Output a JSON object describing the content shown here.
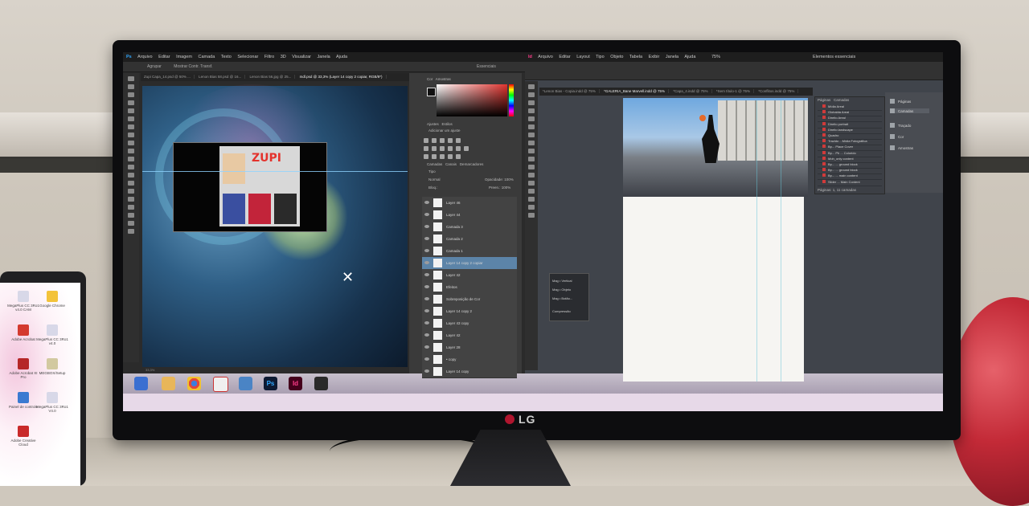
{
  "photoshop": {
    "logo": "Ps",
    "menu": [
      "Arquivo",
      "Editar",
      "Imagem",
      "Camada",
      "Texto",
      "Selecionar",
      "Filtro",
      "3D",
      "Visualizar",
      "Janela",
      "Ajuda"
    ],
    "options_blend": "Agrupar",
    "options_show": "Mostrar Contr. Transf.",
    "workspace": "Essenciais",
    "tabs": [
      "Zupi Capa_14.psd @ 50% ...",
      "Lenon Bias 58.psd @ 16...",
      "Lenon Bias 56.jpg @ 25...",
      "mdl.psd @ 33,3% (Layer 14 copy 2 copiar, RGB/8*)"
    ],
    "canvas_logo": "ZUPI",
    "panels": {
      "color_tabs": [
        "Cor",
        "Amostras"
      ],
      "adjustments_tabs": [
        "Ajustes",
        "Estilos"
      ],
      "adjustments_title": "Adicionar um ajuste",
      "layers_tabs": [
        "Camadas",
        "Canais",
        "Demarcadores"
      ],
      "kind_label": "Tipo",
      "mode": "Normal",
      "opacity_label": "Opacidade:",
      "opacity_value": "100%",
      "lock_label": "Bloq.:",
      "fill_label": "Preen.:",
      "fill_value": "100%"
    },
    "layers": [
      {
        "name": "Layer 46"
      },
      {
        "name": "Layer 44"
      },
      {
        "name": "Camada 3"
      },
      {
        "name": "Camada 2"
      },
      {
        "name": "Camada 1"
      },
      {
        "name": "Layer 14 copy 2 copiar",
        "selected": true
      },
      {
        "name": "Layer 42"
      },
      {
        "name": "Efeitos"
      },
      {
        "name": "Sobreposição de Cor"
      },
      {
        "name": "Layer 14 copy 2"
      },
      {
        "name": "Layer 43 copy"
      },
      {
        "name": "Layer 42"
      },
      {
        "name": "Layer 28"
      },
      {
        "name": "• copy"
      },
      {
        "name": "Layer 14 copy"
      }
    ],
    "status": "33,3%"
  },
  "indesign": {
    "logo": "Id",
    "menu": [
      "Arquivo",
      "Editar",
      "Layout",
      "Tipo",
      "Objeto",
      "Tabela",
      "Exibir",
      "Janela",
      "Ajuda"
    ],
    "zoom": "75%",
    "workspace": "Elementos essenciais",
    "tabs": [
      "*Lenon Bias - Copia.indd @ 75%",
      "*GALERIA_Bane Marvell.indd @ 75%",
      "*Capa_4.indd @ 75%",
      "*Sem título-1 @ 75%",
      "*Conflitos.indd @ 75%"
    ],
    "layers_tabs": [
      "Páginas",
      "Camadas"
    ],
    "layers": [
      "Mídia Areal",
      "Globalda Areal",
      "Direito Areal",
      "Direito portrait",
      "Direito landscape",
      "Quadro",
      "Trazido ...Mídia Fotográfica",
      "Bp... Place Cover",
      "Bp... Ph ... Colorido",
      "Moh_only content",
      "Bp... ... ground block",
      "Bp... ... ground block",
      "Bp... ... main content",
      "Slider ... Main Content"
    ],
    "layers_status": "Páginas: 1, 11 camadas",
    "side_panel": [
      "Páginas",
      "Camadas",
      "Traçado",
      "Cor",
      "Amostras"
    ],
    "float_panel": [
      "Mag • Vertical",
      "Mag • Objeto",
      "Mag • Botão...",
      "Compressão"
    ]
  },
  "taskbar": {
    "icons": [
      "windows-start",
      "file-explorer",
      "chrome",
      "acrobat",
      "media",
      "photoshop",
      "indesign",
      "notes"
    ]
  },
  "monitor": {
    "brand": "LG"
  },
  "phone": {
    "icons": [
      {
        "label": "MegaPlus CC 3Ro1 v4.0 CAM"
      },
      {
        "label": "Google Chrome"
      },
      {
        "label": "Adobe Acrobat"
      },
      {
        "label": "MegaPlus CC 3Ro1 v4.0"
      },
      {
        "label": "Adobe Acrobat XI Pro"
      },
      {
        "label": "MEGBOX/Setup"
      },
      {
        "label": "Painel de controle"
      },
      {
        "label": "MegaPlus CC 3Ro1 V4.0"
      },
      {
        "label": "Adobe Creative Cloud"
      }
    ]
  }
}
